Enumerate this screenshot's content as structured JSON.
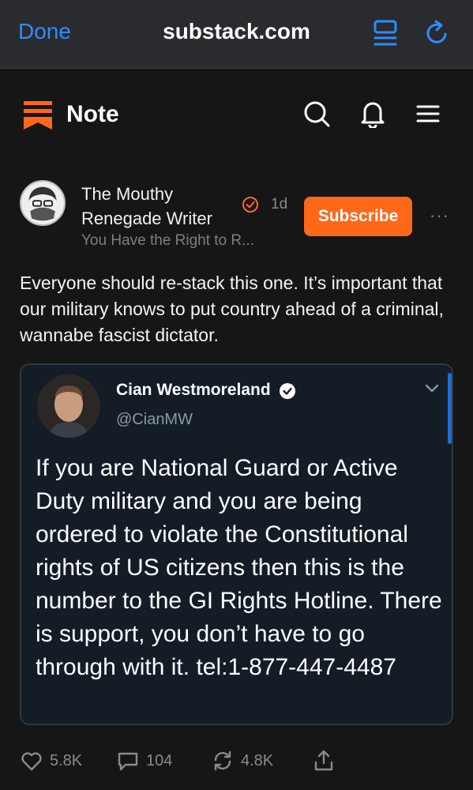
{
  "browser": {
    "done_label": "Done",
    "url": "substack.com",
    "icons": [
      "reader-icon",
      "reload-icon"
    ]
  },
  "header": {
    "title": "Note",
    "icons": [
      "substack-logo-icon",
      "search-icon",
      "bell-icon",
      "menu-icon"
    ]
  },
  "author": {
    "name": "The Mouthy Renegade Writer",
    "publication": "You Have the Right to R...",
    "time": "1d",
    "subscribe_label": "Subscribe",
    "more_label": "···"
  },
  "note": {
    "text": "Everyone should re-stack this one. It’s important that our military knows to put country ahead of a criminal, wannabe fascist dictator."
  },
  "embed": {
    "name": "Cian Westmoreland",
    "handle": "@CianMW",
    "text": "If you are National Guard or Active Duty military and you are being ordered to violate the Constitutional rights of US citizens then this is the number to the GI Rights Hotline. There is support, you don’t have to go through with it. tel:1-877-447-4487"
  },
  "actions": {
    "likes": "5.8K",
    "comments": "104",
    "restacks": "4.8K"
  },
  "colors": {
    "accent": "#ff6719",
    "link_blue": "#2f8cff",
    "background": "#161616"
  }
}
